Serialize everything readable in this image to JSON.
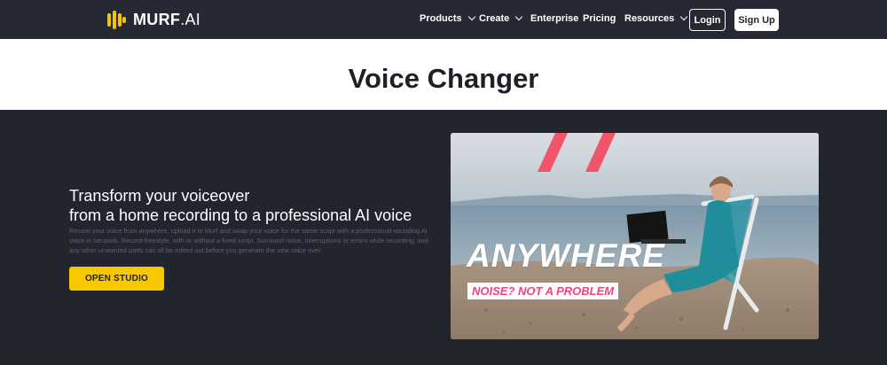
{
  "nav": {
    "logo_brand": "MURF",
    "logo_suffix": ".AI",
    "items": [
      {
        "label": "Products",
        "dropdown": true
      },
      {
        "label": "Create",
        "dropdown": true
      },
      {
        "label": "Enterprise",
        "dropdown": false
      },
      {
        "label": "Pricing",
        "dropdown": false
      },
      {
        "label": "Resources",
        "dropdown": true
      }
    ],
    "login_label": "Login",
    "signup_label": "Sign Up"
  },
  "page": {
    "title": "Voice Changer"
  },
  "hero": {
    "heading_line1": "Transform your voiceover",
    "heading_line2": "from a home recording to a professional AI voice",
    "description": "Record your voice from anywhere, upload it to Murf and swap your voice for the same script with a professional sounding AI voice in seconds. Record freestyle, with or without a fixed script. Surround noise, interruptions or errors while recording, and any other unwanted parts can all be edited out before you generate the new voice over.",
    "cta_label": "OPEN STUDIO",
    "image": {
      "headline": "ANYWHERE",
      "tagline": "NOISE? NOT A PROBLEM"
    }
  },
  "colors": {
    "nav_bg": "#262833",
    "hero_bg": "#22242e",
    "accent_yellow": "#f7c800",
    "accent_pink": "#f0457a",
    "title_band_bg": "#ffffff"
  }
}
